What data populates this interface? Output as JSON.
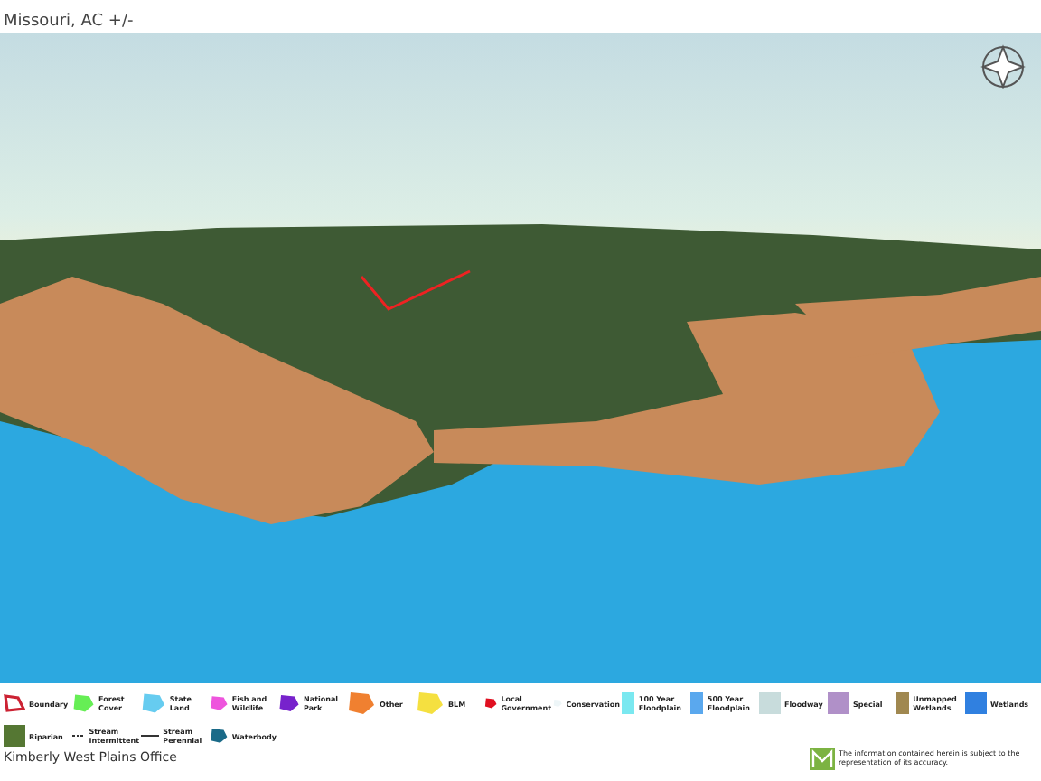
{
  "header": {
    "location": "Missouri,  AC +/-"
  },
  "legend": {
    "items": [
      {
        "kind": "outline",
        "label": "Boundary",
        "color": "#cc2233"
      },
      {
        "kind": "swatch",
        "label": "Forest Cover",
        "color": "#66ee55"
      },
      {
        "kind": "swatch",
        "label": "State Land",
        "color": "#66ccf0"
      },
      {
        "kind": "swatch",
        "label": "Fish and Wildlife",
        "color": "#ee55dd"
      },
      {
        "kind": "swatch",
        "label": "National Park",
        "color": "#7722cc"
      },
      {
        "kind": "swatch",
        "label": "Other",
        "color": "#f08030"
      },
      {
        "kind": "swatch",
        "label": "BLM",
        "color": "#f5e040"
      },
      {
        "kind": "swatch",
        "label": "Local Government",
        "color": "#e01020"
      },
      {
        "kind": "swatch",
        "label": "Conservation",
        "color": "#eef6f8"
      },
      {
        "kind": "square",
        "label": "100 Year Floodplain",
        "color": "#7ae8f0"
      },
      {
        "kind": "square",
        "label": "500 Year Floodplain",
        "color": "#5aa8ee"
      },
      {
        "kind": "square",
        "label": "Floodway",
        "color": "#c8dcdc"
      },
      {
        "kind": "square",
        "label": "Special",
        "color": "#b090c8"
      },
      {
        "kind": "square",
        "label": "Unmapped Wetlands",
        "color": "#a08850"
      },
      {
        "kind": "square",
        "label": "Wetlands",
        "color": "#3080e0"
      },
      {
        "kind": "square",
        "label": "Riparian",
        "color": "#557733"
      },
      {
        "kind": "dashed",
        "label": "Stream Intermittent",
        "color": "#333333"
      },
      {
        "kind": "line",
        "label": "Stream Perennial",
        "color": "#333333"
      },
      {
        "kind": "swatch",
        "label": "Waterbody",
        "color": "#1a6a88"
      }
    ]
  },
  "footer": {
    "office": "Kimberly West Plains Office",
    "disclaimer": "The information contained herein is subject to the representation of its accuracy."
  }
}
